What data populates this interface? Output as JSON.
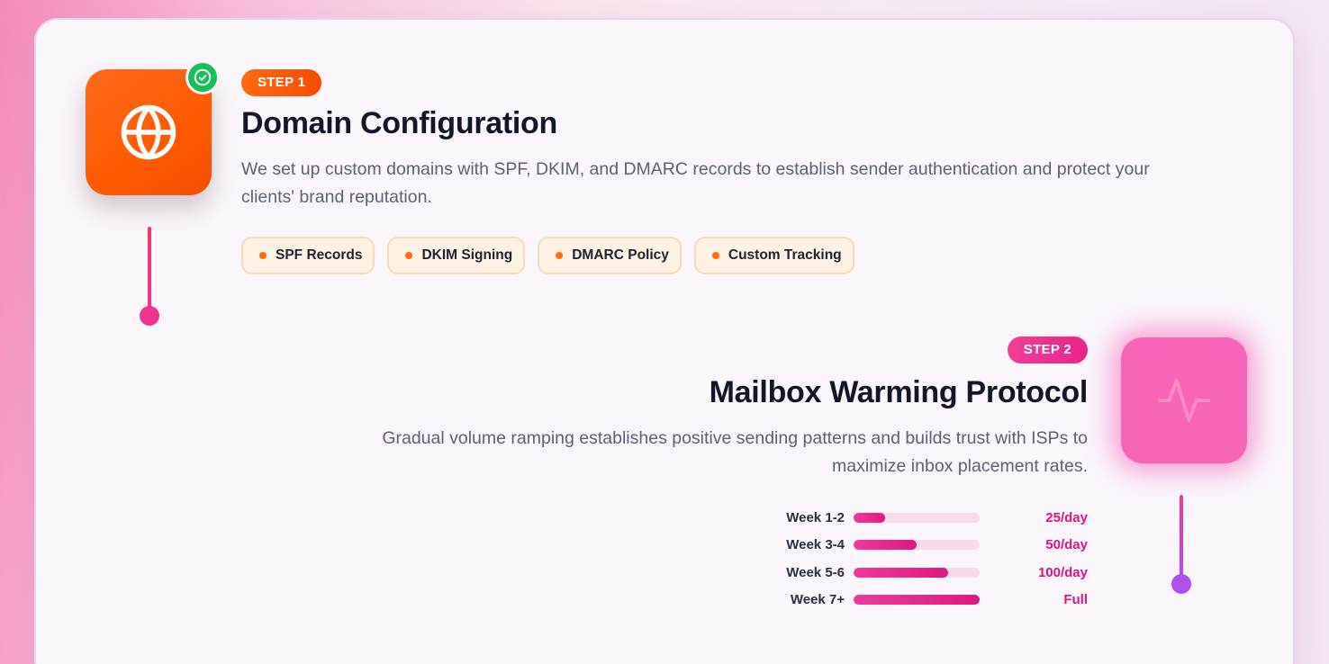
{
  "colors": {
    "step1_accent": "#ff5a00",
    "step2_accent": "#e8248a",
    "success": "#16c05a",
    "connector_end": "#b14ef0"
  },
  "step1": {
    "badge": "STEP 1",
    "icon": "globe-icon",
    "status_icon": "check-circle-icon",
    "title": "Domain Configuration",
    "description": "We set up custom domains with SPF, DKIM, and DMARC records to establish sender authentication and protect your clients' brand reputation.",
    "tags": [
      "SPF Records",
      "DKIM Signing",
      "DMARC Policy",
      "Custom Tracking"
    ]
  },
  "step2": {
    "badge": "STEP 2",
    "icon": "activity-pulse-icon",
    "title": "Mailbox Warming Protocol",
    "description": "Gradual volume ramping establishes positive sending patterns and builds trust with ISPs to maximize inbox placement rates.",
    "schedule": [
      {
        "label": "Week 1-2",
        "value": "25/day",
        "progress": 0.25
      },
      {
        "label": "Week 3-4",
        "value": "50/day",
        "progress": 0.5
      },
      {
        "label": "Week 5-6",
        "value": "100/day",
        "progress": 0.75
      },
      {
        "label": "Week 7+",
        "value": "Full",
        "progress": 1.0
      }
    ]
  }
}
